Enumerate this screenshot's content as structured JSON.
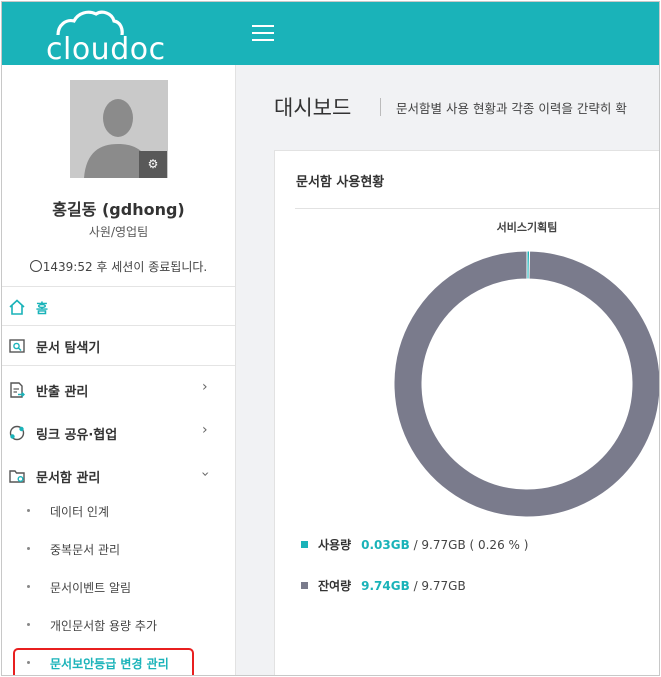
{
  "brand": {
    "logo_text": "cloudoc",
    "accent": "#1ab3b9"
  },
  "user": {
    "name": "홍길동 (gdhong)",
    "role": "사원/영업팀",
    "session_text": "1439:52 후 세션이 종료됩니다."
  },
  "nav": {
    "home": "홈",
    "explorer": "문서 탐색기",
    "export": "반출 관리",
    "link_share": "링크 공유·협업",
    "docbox": "문서함 관리"
  },
  "docbox_sub": [
    "데이터 인계",
    "중복문서 관리",
    "문서이벤트 알림",
    "개인문서함 용량 추가",
    "문서보안등급 변경 관리"
  ],
  "main": {
    "title": "대시보드",
    "description": "문서함별 사용 현황과 각종 이력을 간략히 확"
  },
  "usage_card": {
    "title": "문서함 사용현황",
    "legend": [
      {
        "label": "사용량",
        "value": "0.03GB",
        "total": "/ 9.77GB ( 0.26 % )",
        "color": "#1ab3b9"
      },
      {
        "label": "잔여량",
        "value": "9.74GB",
        "total": "/ 9.77GB",
        "color": "#7a7b8c"
      }
    ]
  },
  "chart_data": {
    "type": "pie",
    "title": "서비스기획팀",
    "unit": "GB",
    "slices": [
      {
        "name": "사용량",
        "value": 0.03,
        "color": "#1ab3b9"
      },
      {
        "name": "잔여량",
        "value": 9.74,
        "color": "#7a7b8c"
      }
    ]
  }
}
